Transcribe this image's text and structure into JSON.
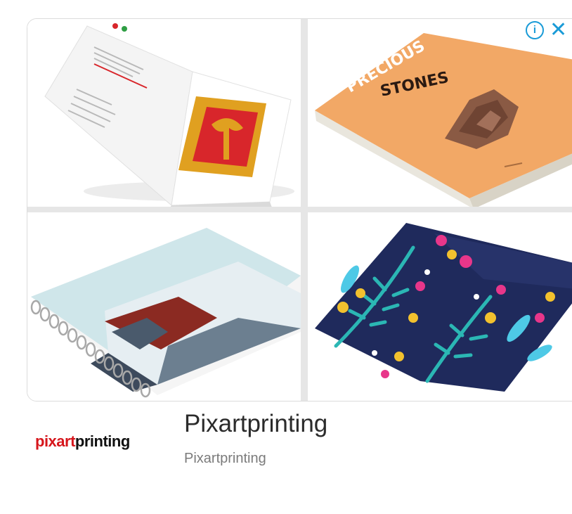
{
  "ad": {
    "images": [
      {
        "alt": "brochure"
      },
      {
        "alt": "book",
        "cover_line1": "PRECIOUS",
        "cover_line2": "STONES"
      },
      {
        "alt": "notebook"
      },
      {
        "alt": "folded-leaflet"
      }
    ],
    "adchoices": {
      "info_glyph": "i",
      "close_glyph": "✕",
      "color": "#1a9bd7"
    }
  },
  "advertiser": {
    "logo_part1": "pixart",
    "logo_part2": "printing",
    "name": "Pixartprinting",
    "display_url": "Pixartprinting",
    "logo_red": "#d6161c"
  }
}
